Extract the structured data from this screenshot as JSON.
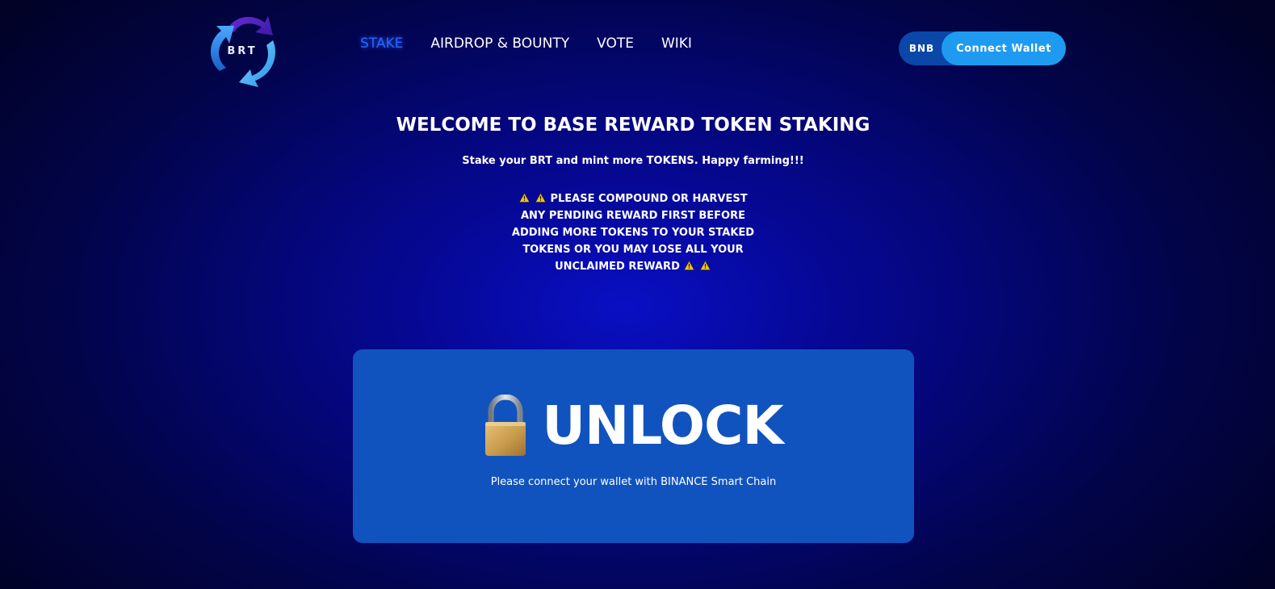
{
  "brand": {
    "logo_text": "BRT",
    "logo_icon": "brt-circular-arrows-logo"
  },
  "nav": {
    "items": [
      {
        "label": "STAKE",
        "active": true
      },
      {
        "label": "AIRDROP & BOUNTY",
        "active": false
      },
      {
        "label": "VOTE",
        "active": false
      },
      {
        "label": "WIKI",
        "active": false
      }
    ]
  },
  "wallet": {
    "network": "BNB",
    "connect_label": "Connect Wallet"
  },
  "hero": {
    "title": "WELCOME TO BASE REWARD TOKEN STAKING",
    "subtitle": "Stake your BRT and mint more TOKENS. Happy farming!!!",
    "warning_lines": [
      "PLEASE COMPOUND OR HARVEST",
      "ANY PENDING REWARD FIRST BEFORE",
      "ADDING MORE TOKENS TO YOUR STAKED",
      "TOKENS OR YOU MAY LOSE ALL YOUR",
      "UNCLAIMED REWARD"
    ],
    "warning_icon": "warning-icon"
  },
  "unlock": {
    "icon": "padlock-icon",
    "title": "UNLOCK",
    "hint": "Please connect your wallet with BINANCE Smart Chain"
  },
  "colors": {
    "active_nav": "#1f6bff",
    "card_bg": "#1153be",
    "connect_button": "#1e9bf0",
    "network_pill": "#0b47a8"
  }
}
